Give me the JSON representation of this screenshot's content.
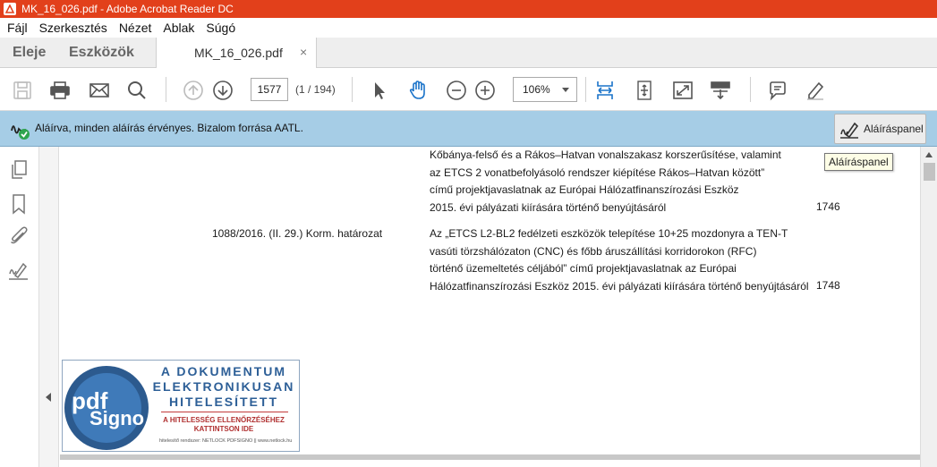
{
  "window": {
    "title": "MK_16_026.pdf - Adobe Acrobat Reader DC"
  },
  "menu": [
    "Fájl",
    "Szerkesztés",
    "Nézet",
    "Ablak",
    "Súgó"
  ],
  "tabs": {
    "home": "Eleje",
    "tools": "Eszközök",
    "document": "MK_16_026.pdf",
    "close": "×"
  },
  "toolbar": {
    "page_number": "1577",
    "page_count": "(1 / 194)",
    "zoom": "106%"
  },
  "signature_bar": {
    "message": "Aláírva, minden aláírás érvényes. Bizalom forrása AATL.",
    "panel_button": "Aláíráspanel"
  },
  "tooltip": "Aláíráspanel",
  "document": {
    "row1": {
      "lines": [
        "Kőbánya-felső és a Rákos–Hatvan vonalszakasz korszerűsítése, valamint",
        "az ETCS 2 vonatbefolyásoló rendszer kiépítése Rákos–Hatvan között”",
        "című projektjavaslatnak az Európai Hálózatfinanszírozási Eszköz",
        "2015. évi pályázati kiírására történő benyújtásáról"
      ],
      "page": "1746"
    },
    "row2": {
      "decree": "1088/2016. (II. 29.) Korm. határozat",
      "lines": [
        "Az „ETCS L2-BL2 fedélzeti eszközök telepítése 10+25 mozdonyra a TEN-T",
        "vasúti törzshálózaton (CNC) és főbb áruszállítási korridorokon (RFC)",
        "történő üzemeltetés céljából” című projektjavaslatnak az Európai",
        "Hálózatfinanszírozási Eszköz 2015. évi pályázati kiírására történő benyújtásáról"
      ],
      "page": "1748"
    }
  },
  "stamp": {
    "logo_pdf": "pdf",
    "logo_signo": "Signo",
    "heading": [
      "A DOKUMENTUM",
      "ELEKTRONIKUSAN",
      "HITELESÍTETT"
    ],
    "sub": [
      "A HITELESSÉG ELLENŐRZÉSÉHEZ",
      "KATTINTSON IDE"
    ],
    "footer": "hitelesítő rendszer: NETLOCK PDFSIGNO  ||  www.netlock.hu"
  },
  "colors": {
    "titlebar": "#e2401b",
    "signature_bar": "#a6cde6",
    "stamp_blue": "#2d5f97",
    "stamp_red": "#b03030"
  },
  "icons": [
    "save-icon",
    "print-icon",
    "email-icon",
    "search-icon",
    "prev-page-icon",
    "next-page-icon",
    "select-cursor-icon",
    "hand-tool-icon",
    "zoom-out-icon",
    "zoom-in-icon",
    "fit-width-icon",
    "fit-page-icon",
    "full-screen-icon",
    "scroll-mode-icon",
    "comment-icon",
    "highlight-icon",
    "thumbnails-icon",
    "bookmark-icon",
    "attachment-icon",
    "signature-icon"
  ]
}
